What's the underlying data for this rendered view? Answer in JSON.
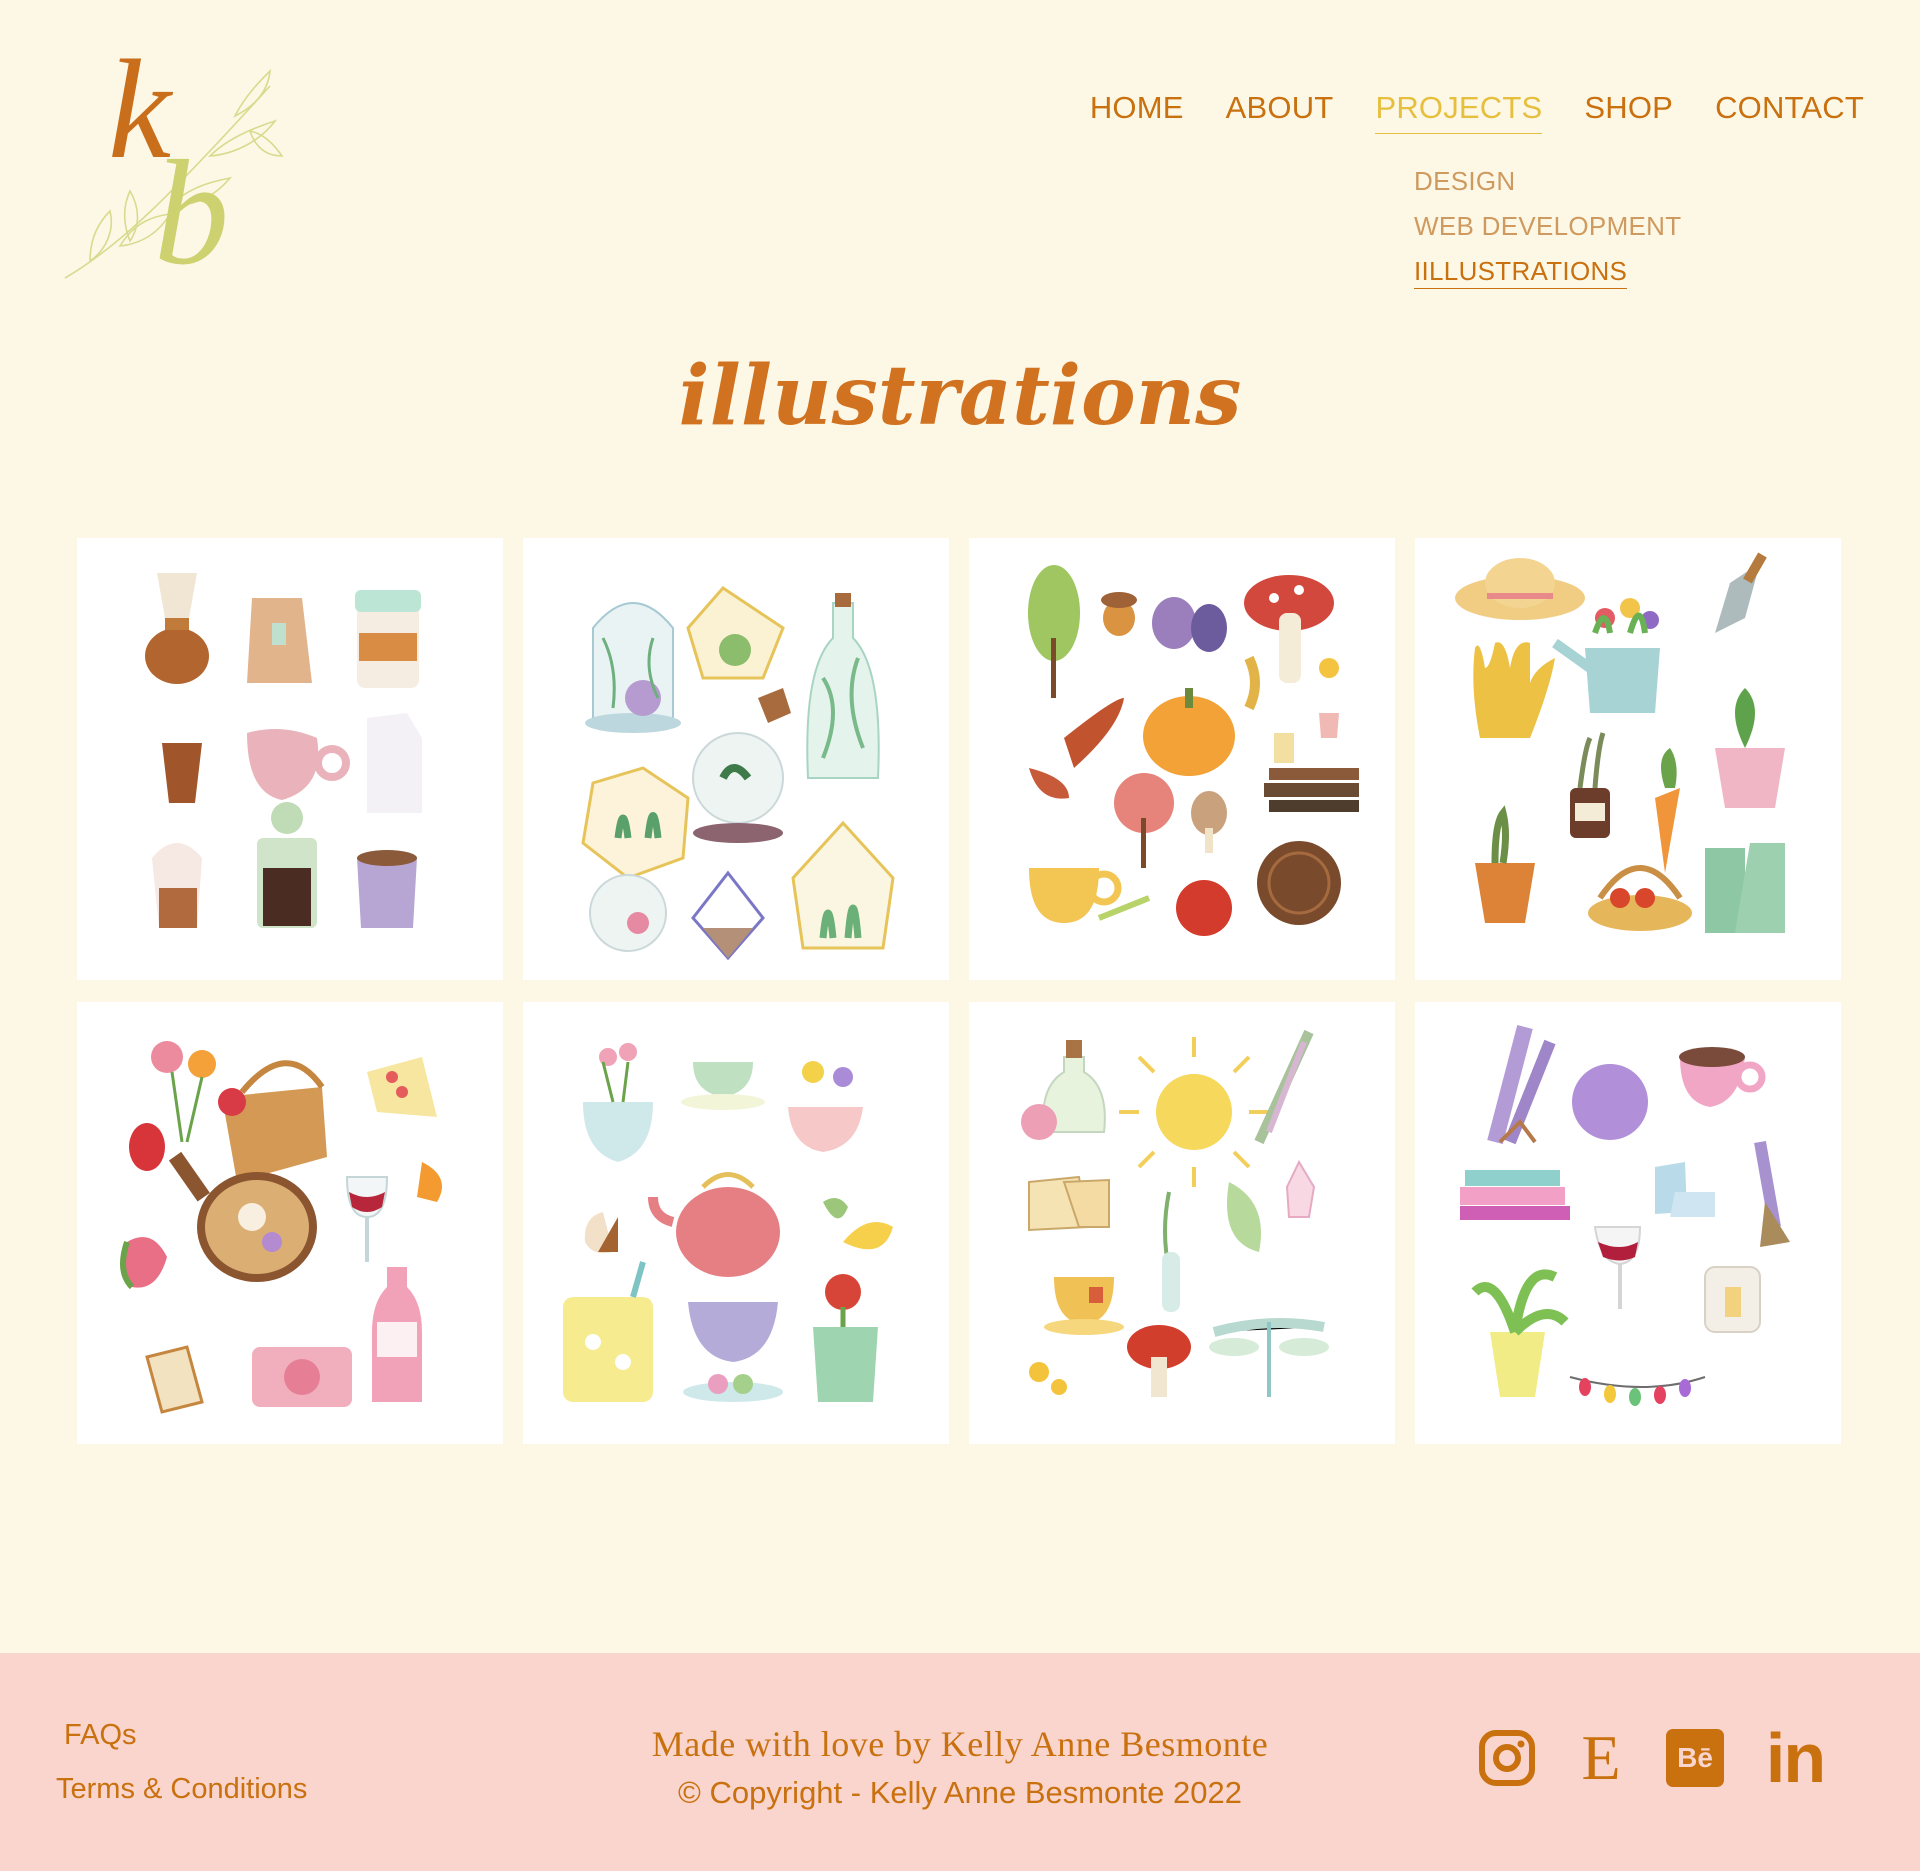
{
  "logo": {
    "k": "k",
    "b": "b"
  },
  "nav": {
    "items": [
      "HOME",
      "ABOUT",
      "PROJECTS",
      "SHOP",
      "CONTACT"
    ],
    "active": "PROJECTS"
  },
  "subnav": {
    "items": [
      "DESIGN",
      "WEB DEVELOPMENT",
      "IILLUSTRATIONS"
    ],
    "current": "IILLUSTRATIONS"
  },
  "page": {
    "title": "illustrations"
  },
  "gallery": [
    "coffee-set",
    "terrarium-set",
    "autumn-set",
    "garden-set",
    "picnic-set",
    "tea-set",
    "herbal-set",
    "cozy-set"
  ],
  "footer": {
    "faqs": "FAQs",
    "terms": "Terms & Conditions",
    "made_with_love": "Made with love by Kelly Anne Besmonte",
    "copyright": "© Copyright - Kelly Anne Besmonte 2022",
    "social": [
      "instagram-icon",
      "etsy-icon",
      "behance-icon",
      "linkedin-icon"
    ],
    "etsy_letter": "E",
    "behance_letters": "Bē",
    "linkedin_letters": "in"
  },
  "colors": {
    "background": "#fdf8e6",
    "accent": "#c9700f",
    "active": "#e7bf3e",
    "footer_bg": "#f9d5cd"
  }
}
